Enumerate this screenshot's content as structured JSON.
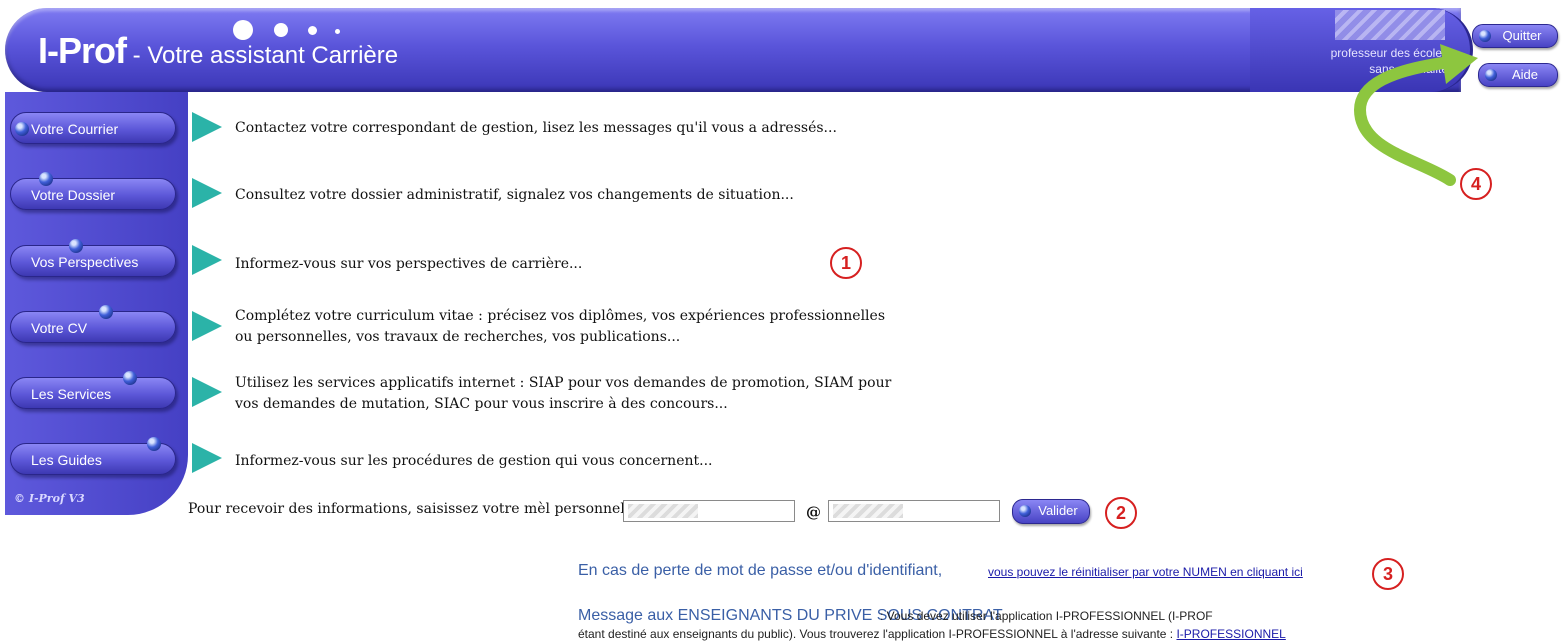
{
  "header": {
    "brand": "I-Prof",
    "tagline": " - Votre assistant Carrière",
    "user_line1": "professeur des écoles",
    "user_line2": "sans spécialité",
    "quit_label": "Quitter",
    "help_label": "Aide"
  },
  "sidebar": {
    "items": [
      {
        "label": "Votre Courrier",
        "description": "Contactez votre correspondant de gestion, lisez les messages qu'il vous a adressés..."
      },
      {
        "label": "Votre Dossier",
        "description": "Consultez votre dossier administratif, signalez vos changements de situation..."
      },
      {
        "label": "Vos Perspectives",
        "description": "Informez-vous sur vos perspectives de carrière..."
      },
      {
        "label": "Votre CV",
        "description_line1": "Complétez votre curriculum vitae : précisez vos diplômes, vos expériences professionnelles",
        "description_line2": "ou personnelles, vos travaux de recherches, vos publications..."
      },
      {
        "label": "Les Services",
        "description_line1": "Utilisez les services applicatifs internet : SIAP pour vos demandes de promotion, SIAM pour",
        "description_line2": "vos demandes de mutation, SIAC pour vous inscrire à des concours..."
      },
      {
        "label": "Les Guides",
        "description": "Informez-vous sur les procédures de gestion qui vous concernent..."
      }
    ],
    "copyright": "© I-Prof  V3"
  },
  "email": {
    "label": "Pour recevoir des informations, saisissez votre mèl personnel :",
    "at": "@",
    "submit_label": "Valider"
  },
  "lost_credentials": {
    "title": "En cas de perte de mot de passe et/ou d'identifiant,",
    "link": "vous pouvez le réinitialiser par votre NUMEN en cliquant ici"
  },
  "private_message": {
    "title": "Message aux ENSEIGNANTS DU PRIVE SOUS CONTRAT",
    "body1": ": Vous devez utiliser l'application I-PROFESSIONNEL (I-PROF",
    "body2": "étant destiné aux enseignants du public). Vous trouverez l'application I-PROFESSIONNEL à l'adresse suivante : ",
    "link": "I-PROFESSIONNEL"
  },
  "annotations": {
    "m1": "1",
    "m2": "2",
    "m3": "3",
    "m4": "4"
  },
  "colors": {
    "accent": "#5a55da",
    "arrow": "#2bb3a8",
    "marker": "#d62020",
    "callout_arrow": "#8dc63f"
  }
}
